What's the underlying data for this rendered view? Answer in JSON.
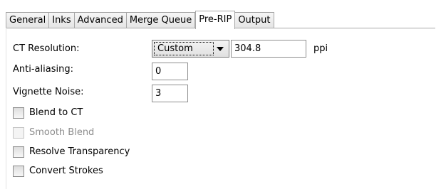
{
  "tabs": [
    {
      "label": "General",
      "active": false
    },
    {
      "label": "Inks",
      "active": false
    },
    {
      "label": "Advanced",
      "active": false
    },
    {
      "label": "Merge Queue",
      "active": false
    },
    {
      "label": "Pre-RIP",
      "active": true
    },
    {
      "label": "Output",
      "active": false
    }
  ],
  "ct_resolution": {
    "label": "CT Resolution:",
    "mode": "Custom",
    "value": "304.8",
    "unit": "ppi"
  },
  "anti_aliasing": {
    "label": "Anti-aliasing:",
    "value": "0"
  },
  "vignette_noise": {
    "label": "Vignette Noise:",
    "value": "3"
  },
  "options": [
    {
      "label": "Blend to CT",
      "checked": false,
      "enabled": true
    },
    {
      "label": "Smooth Blend",
      "checked": false,
      "enabled": false
    },
    {
      "label": "Resolve Transparency",
      "checked": false,
      "enabled": true
    },
    {
      "label": "Convert Strokes",
      "checked": false,
      "enabled": true
    }
  ]
}
